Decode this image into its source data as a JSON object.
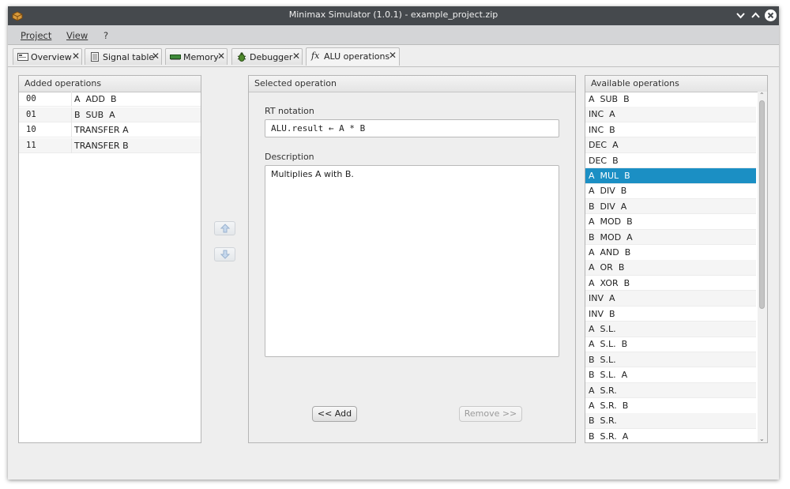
{
  "window": {
    "title": "Minimax Simulator (1.0.1) - example_project.zip"
  },
  "menu": {
    "items": [
      "Project",
      "View",
      "?"
    ]
  },
  "tabs": [
    {
      "label": "Overview",
      "icon": "overview-icon"
    },
    {
      "label": "Signal table",
      "icon": "signal-table-icon"
    },
    {
      "label": "Memory",
      "icon": "memory-icon"
    },
    {
      "label": "Debugger",
      "icon": "bug-icon"
    },
    {
      "label": "ALU operations",
      "icon": "fx-icon",
      "active": true
    }
  ],
  "added": {
    "title": "Added operations",
    "rows": [
      {
        "code": "00",
        "name": "A  ADD  B"
      },
      {
        "code": "01",
        "name": "B  SUB  A"
      },
      {
        "code": "10",
        "name": "TRANSFER A"
      },
      {
        "code": "11",
        "name": "TRANSFER B"
      }
    ]
  },
  "selected": {
    "title": "Selected operation",
    "rt_label": "RT notation",
    "rt_value": "ALU.result ← A * B",
    "desc_label": "Description",
    "desc_value": "Multiplies A with B.",
    "add_button": "<< Add",
    "remove_button": "Remove >>"
  },
  "available": {
    "title": "Available operations",
    "selected_index": 5,
    "items": [
      "A  SUB  B",
      "INC  A",
      "INC  B",
      "DEC  A",
      "DEC  B",
      "A  MUL  B",
      "A  DIV  B",
      "B  DIV  A",
      "A  MOD  B",
      "B  MOD  A",
      "A  AND  B",
      "A  OR  B",
      "A  XOR  B",
      "INV  A",
      "INV  B",
      "A  S.L.",
      "A  S.L.  B",
      "B  S.L.",
      "B  S.L.  A",
      "A  S.R.",
      "A  S.R.  B",
      "B  S.R.",
      "B  S.R.  A"
    ]
  },
  "colors": {
    "titlebar": "#45494d",
    "selection": "#1b8fc4"
  }
}
